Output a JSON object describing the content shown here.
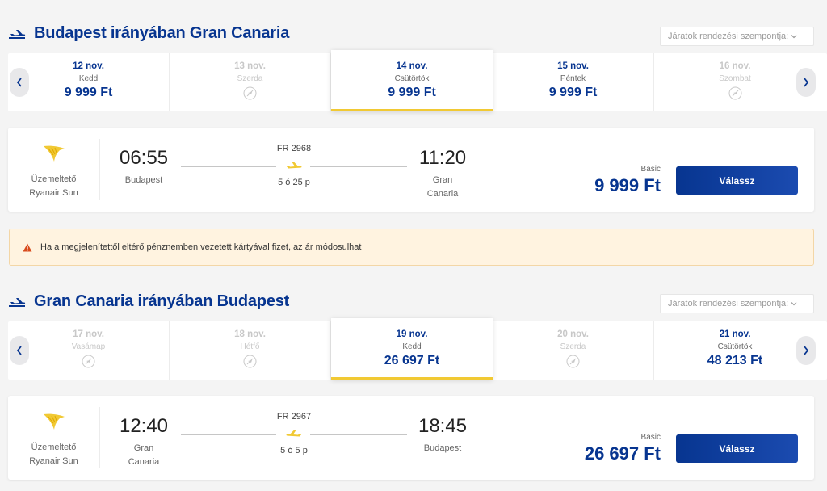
{
  "outbound": {
    "title": "Budapest irányában Gran Canaria",
    "sort_label": "Járatok rendezési szempontja:",
    "dates": [
      {
        "date": "12 nov.",
        "weekday": "Kedd",
        "price": "9 999 Ft",
        "available": true,
        "selected": false
      },
      {
        "date": "13 nov.",
        "weekday": "Szerda",
        "price": "",
        "available": false,
        "selected": false
      },
      {
        "date": "14 nov.",
        "weekday": "Csütörtök",
        "price": "9 999 Ft",
        "available": true,
        "selected": true
      },
      {
        "date": "15 nov.",
        "weekday": "Péntek",
        "price": "9 999 Ft",
        "available": true,
        "selected": false
      },
      {
        "date": "16 nov.",
        "weekday": "Szombat",
        "price": "",
        "available": false,
        "selected": false
      }
    ],
    "flight": {
      "operator_label": "Üzemeltető",
      "operator_name": "Ryanair Sun",
      "dep_time": "06:55",
      "dep_city": "Budapest",
      "flight_no": "FR 2968",
      "duration": "5 ó 25 p",
      "arr_time": "11:20",
      "arr_city": "Gran Canaria",
      "fare_type": "Basic",
      "price": "9 999 Ft",
      "select_label": "Válassz"
    }
  },
  "notice": {
    "text": "Ha a megjelenítettől eltérő pénznemben vezetett kártyával fizet, az ár módosulhat",
    "color": "#fff3e0"
  },
  "inbound": {
    "title": "Gran Canaria irányában Budapest",
    "sort_label": "Járatok rendezési szempontja:",
    "dates": [
      {
        "date": "17 nov.",
        "weekday": "Vasámap",
        "price": "",
        "available": false,
        "selected": false
      },
      {
        "date": "18 nov.",
        "weekday": "Hétfő",
        "price": "",
        "available": false,
        "selected": false
      },
      {
        "date": "19 nov.",
        "weekday": "Kedd",
        "price": "26 697 Ft",
        "available": true,
        "selected": true
      },
      {
        "date": "20 nov.",
        "weekday": "Szerda",
        "price": "",
        "available": false,
        "selected": false
      },
      {
        "date": "21 nov.",
        "weekday": "Csütörtök",
        "price": "48 213 Ft",
        "available": true,
        "selected": false
      }
    ],
    "flight": {
      "operator_label": "Üzemeltető",
      "operator_name": "Ryanair Sun",
      "dep_time": "12:40",
      "dep_city": "Gran Canaria",
      "flight_no": "FR 2967",
      "duration": "5 ó 5 p",
      "arr_time": "18:45",
      "arr_city": "Budapest",
      "fare_type": "Basic",
      "price": "26 697 Ft",
      "select_label": "Válassz"
    }
  },
  "colors": {
    "brand_blue": "#073590",
    "accent_yellow": "#f1c933",
    "page_bg": "#f4f4f4"
  }
}
